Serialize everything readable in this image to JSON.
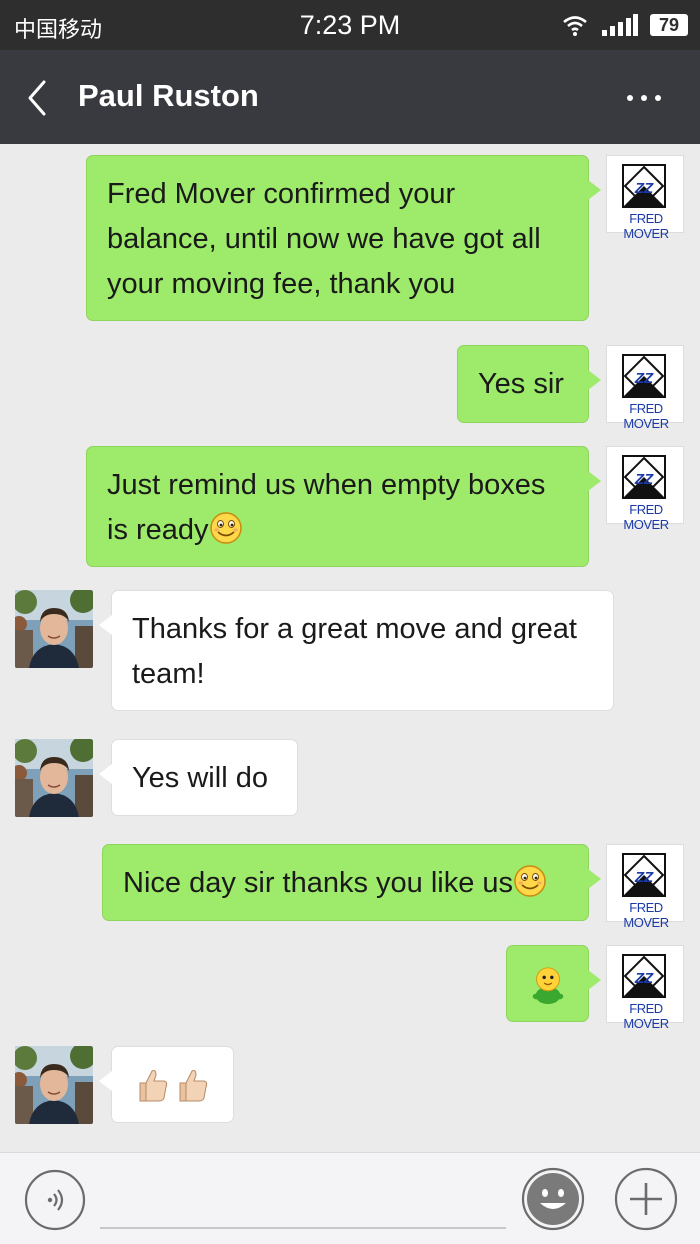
{
  "status_bar": {
    "carrier": "中国移动",
    "time": "7:23 PM",
    "battery": "79"
  },
  "header": {
    "title": "Paul Ruston"
  },
  "logo_text": "FRED MOVER",
  "messages": [
    {
      "side": "right",
      "text": "Fred Mover confirmed your balance, until now we have got all your moving fee, thank you"
    },
    {
      "side": "right",
      "text": "Yes sir"
    },
    {
      "side": "right",
      "text": "Just remind us when empty boxes is ready",
      "emoji": "smiley-icon"
    },
    {
      "side": "left",
      "text": "Thanks for a great move and great team!"
    },
    {
      "side": "left",
      "text": "Yes will do"
    },
    {
      "side": "right",
      "text": "Nice day sir thanks you like us",
      "emoji": "smiley-icon"
    },
    {
      "side": "right",
      "sticker": "green-chick-sticker-icon"
    },
    {
      "side": "left",
      "sticker": "thumbs-up-icon"
    }
  ],
  "colors": {
    "header_bg": "#393a3f",
    "outgoing_bubble": "#9eea6a",
    "incoming_bubble": "#ffffff",
    "chat_bg": "#ebebeb"
  }
}
